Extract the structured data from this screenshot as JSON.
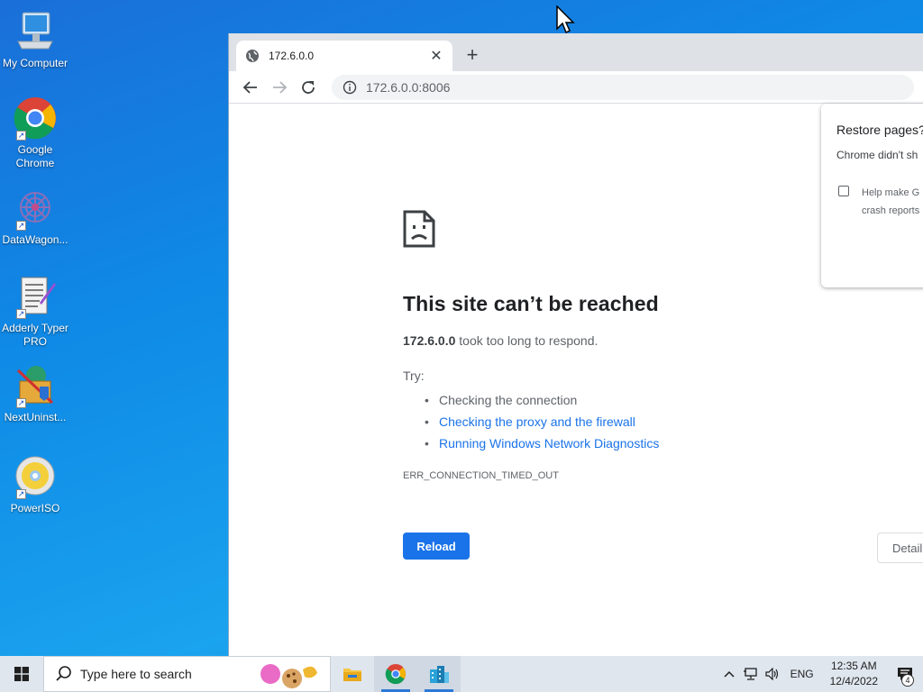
{
  "desktop": {
    "icons": [
      {
        "label": "My Computer"
      },
      {
        "label": "Google Chrome"
      },
      {
        "label": "DataWagon..."
      },
      {
        "label": "Adderly Typer PRO"
      },
      {
        "label": "NextUninst..."
      },
      {
        "label": "PowerISO"
      }
    ]
  },
  "browser": {
    "tab_title": "172.6.0.0",
    "address": "172.6.0.0:8006",
    "error": {
      "headline": "This site can’t be reached",
      "host": "172.6.0.0",
      "message": " took too long to respond.",
      "try_label": "Try:",
      "suggestions": [
        {
          "text": "Checking the connection"
        },
        {
          "text": "Checking the proxy and the firewall"
        },
        {
          "text": "Running Windows Network Diagnostics"
        }
      ],
      "code": "ERR_CONNECTION_TIMED_OUT",
      "reload_label": "Reload",
      "details_label": "Detail"
    },
    "restore_bubble": {
      "title": "Restore pages?",
      "body": "Chrome didn't sh",
      "checkbox_line1": "Help make G",
      "checkbox_line2": "crash reports"
    }
  },
  "taskbar": {
    "search_placeholder": "Type here to search",
    "language": "ENG",
    "time": "12:35 AM",
    "date": "12/4/2022",
    "notification_count": "4"
  },
  "colors": {
    "accent": "#1a73e8",
    "link": "#1a73e8"
  }
}
